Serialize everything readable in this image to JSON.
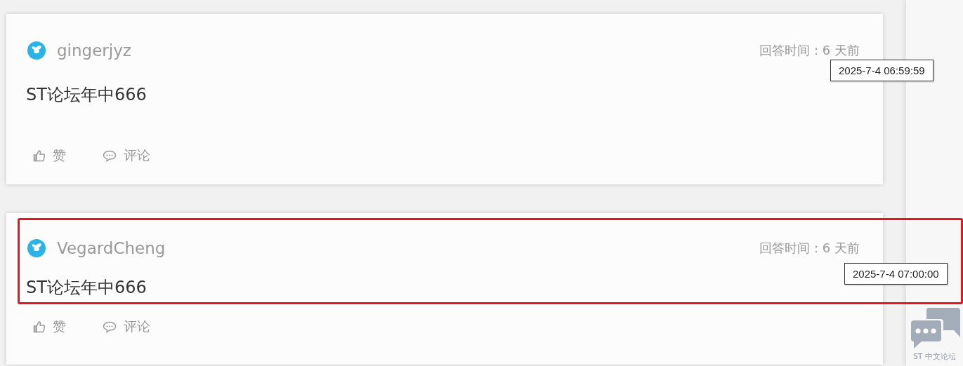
{
  "answers": [
    {
      "user": "gingerjyz",
      "time_label": "回答时间：",
      "time_value": "6 天前",
      "content": "ST论坛年中666",
      "tooltip": "2025-7-4 06:59:59",
      "like_label": "赞",
      "comment_label": "评论",
      "highlighted": false
    },
    {
      "user": "VegardCheng",
      "time_label": "回答时间：",
      "time_value": "6 天前",
      "content": "ST论坛年中666",
      "tooltip": "2025-7-4 07:00:00",
      "like_label": "赞",
      "comment_label": "评论",
      "highlighted": true
    }
  ],
  "float_widget": {
    "label": "ST 中文论坛"
  }
}
